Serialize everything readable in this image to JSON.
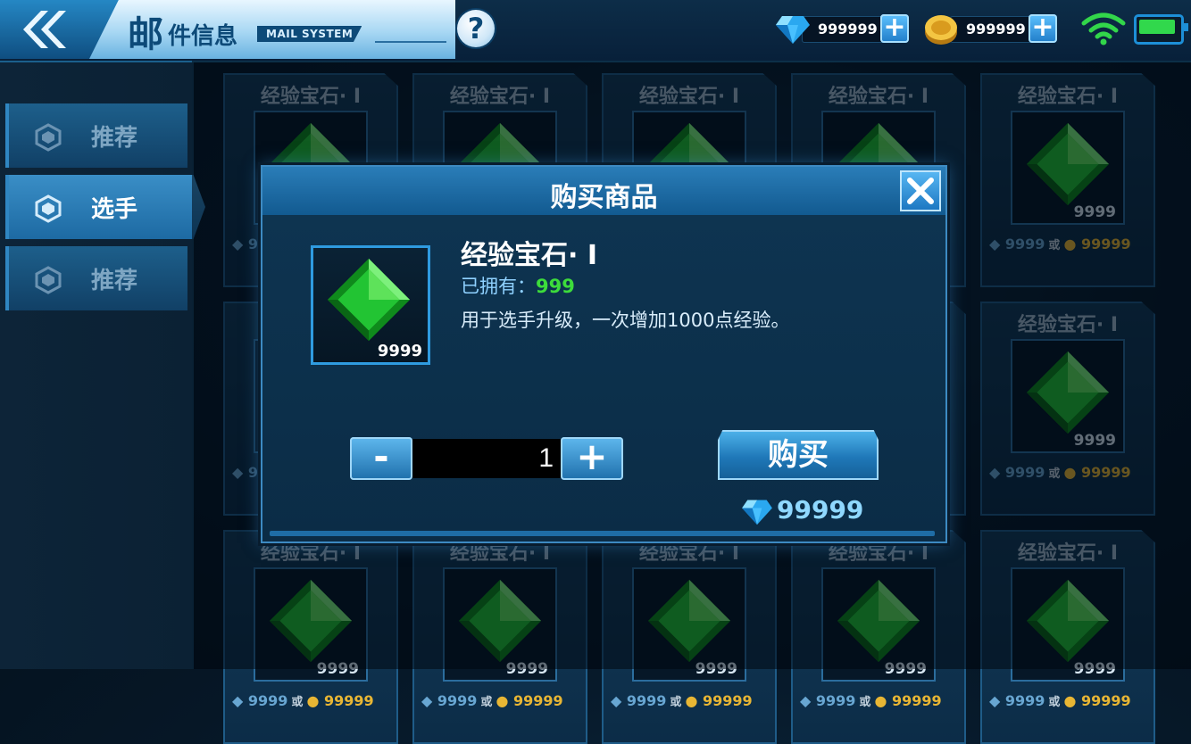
{
  "header": {
    "title_main": "邮",
    "title_rest": "件信息",
    "title_en": "MAIL SYSTEM",
    "help_label": "?"
  },
  "currencies": {
    "diamond": "999999",
    "gold": "999999"
  },
  "sidebar": {
    "tabs": [
      {
        "label": "推荐",
        "active": false
      },
      {
        "label": "选手",
        "active": true
      },
      {
        "label": "推荐",
        "active": false
      }
    ]
  },
  "shop": {
    "items": [
      {
        "name": "经验宝石· I",
        "qty": "9999",
        "diamond_price": "9999",
        "or": "或",
        "gold_price": "99999"
      }
    ]
  },
  "modal": {
    "title": "购买商品",
    "item_name": "经验宝石· I",
    "item_qty": "9999",
    "owned_label": "已拥有：",
    "owned_value": "999",
    "description": "用于选手升级，一次增加1000点经验。",
    "minus_label": "-",
    "plus_label": "+",
    "quantity": "1",
    "buy_label": "购买",
    "price": "99999"
  },
  "colors": {
    "accent": "#2f86c2",
    "owned_green": "#3ddc3b",
    "gold": "#e8b634",
    "gem_green": "#22c433"
  }
}
